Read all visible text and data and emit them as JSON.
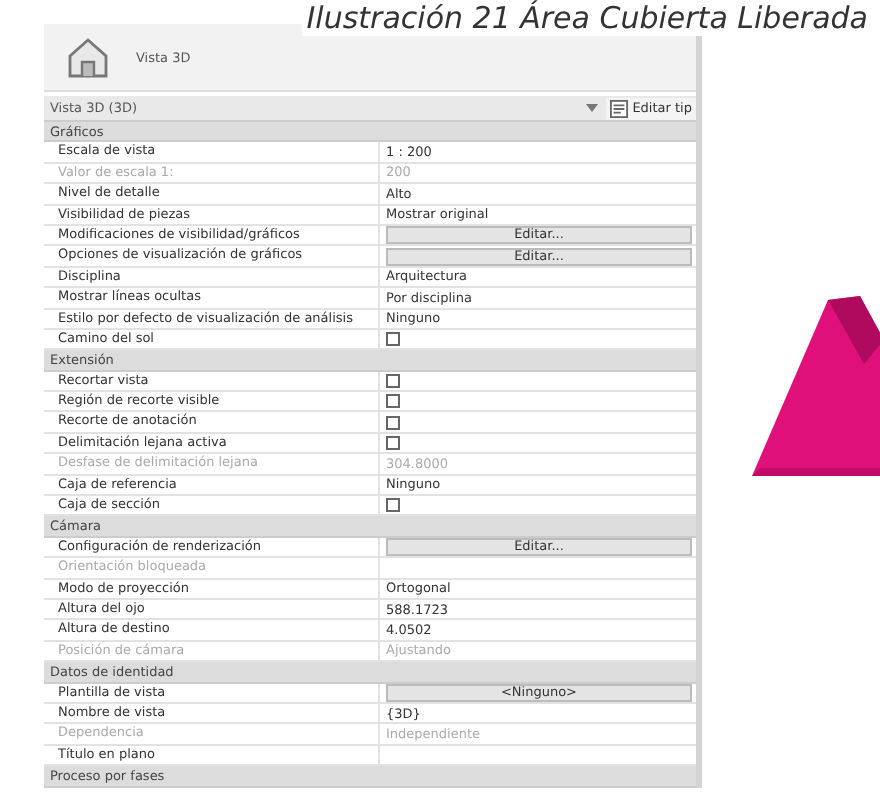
{
  "caption": "Ilustración 21 Área Cubierta Liberada",
  "header": {
    "title": "Vista 3D"
  },
  "type_selector": {
    "value": "Vista 3D (3D)",
    "edit_button": "Editar tip"
  },
  "sections": [
    {
      "title": "Gráficos",
      "rows": [
        {
          "kind": "text",
          "label": "Escala de vista",
          "value": "1 : 200",
          "disabled": false
        },
        {
          "kind": "text",
          "label": "Valor de escala    1:",
          "value": "200",
          "disabled": true
        },
        {
          "kind": "text",
          "label": "Nivel de detalle",
          "value": "Alto",
          "disabled": false
        },
        {
          "kind": "text",
          "label": "Visibilidad de piezas",
          "value": "Mostrar original",
          "disabled": false
        },
        {
          "kind": "button",
          "label": "Modificaciones de visibilidad/gráficos",
          "value": "Editar...",
          "disabled": false
        },
        {
          "kind": "button",
          "label": "Opciones de visualización de gráficos",
          "value": "Editar...",
          "disabled": false
        },
        {
          "kind": "text",
          "label": "Disciplina",
          "value": "Arquitectura",
          "disabled": false
        },
        {
          "kind": "text",
          "label": "Mostrar líneas ocultas",
          "value": "Por disciplina",
          "disabled": false
        },
        {
          "kind": "text",
          "label": "Estilo por defecto de visualización de análisis",
          "value": "Ninguno",
          "disabled": false
        },
        {
          "kind": "checkbox",
          "label": "Camino del sol",
          "checked": false,
          "disabled": false
        }
      ]
    },
    {
      "title": "Extensión",
      "rows": [
        {
          "kind": "checkbox",
          "label": "Recortar vista",
          "checked": false,
          "disabled": false
        },
        {
          "kind": "checkbox",
          "label": "Región de recorte visible",
          "checked": false,
          "disabled": false
        },
        {
          "kind": "checkbox",
          "label": "Recorte de anotación",
          "checked": false,
          "disabled": false
        },
        {
          "kind": "checkbox",
          "label": "Delimitación lejana activa",
          "checked": false,
          "disabled": false
        },
        {
          "kind": "text",
          "label": "Desfase de delimitación lejana",
          "value": "304.8000",
          "disabled": true
        },
        {
          "kind": "text",
          "label": "Caja de referencia",
          "value": "Ninguno",
          "disabled": false
        },
        {
          "kind": "checkbox",
          "label": "Caja de sección",
          "checked": false,
          "disabled": false
        }
      ]
    },
    {
      "title": "Cámara",
      "rows": [
        {
          "kind": "button",
          "label": "Configuración de renderización",
          "value": "Editar...",
          "disabled": false
        },
        {
          "kind": "text",
          "label": "Orientación bloqueada",
          "disabled": true
        },
        {
          "kind": "text",
          "label": "Modo de proyección",
          "value": "Ortogonal",
          "disabled": false
        },
        {
          "kind": "text",
          "label": "Altura del ojo",
          "value": "588.1723",
          "disabled": false
        },
        {
          "kind": "text",
          "label": "Altura de destino",
          "value": "4.0502",
          "disabled": false
        },
        {
          "kind": "text",
          "label": "Posición de cámara",
          "value": "Ajustando",
          "disabled": true
        }
      ]
    },
    {
      "title": "Datos de identidad",
      "rows": [
        {
          "kind": "button",
          "label": "Plantilla de vista",
          "value": "<Ninguno>",
          "disabled": false
        },
        {
          "kind": "text",
          "label": "Nombre de vista",
          "value": "{3D}",
          "disabled": false
        },
        {
          "kind": "text",
          "label": "Dependencia",
          "value": "Independiente",
          "disabled": true
        },
        {
          "kind": "text",
          "label": "Título en plano",
          "disabled": false
        }
      ]
    },
    {
      "title": "Proceso por fases"
    }
  ]
}
